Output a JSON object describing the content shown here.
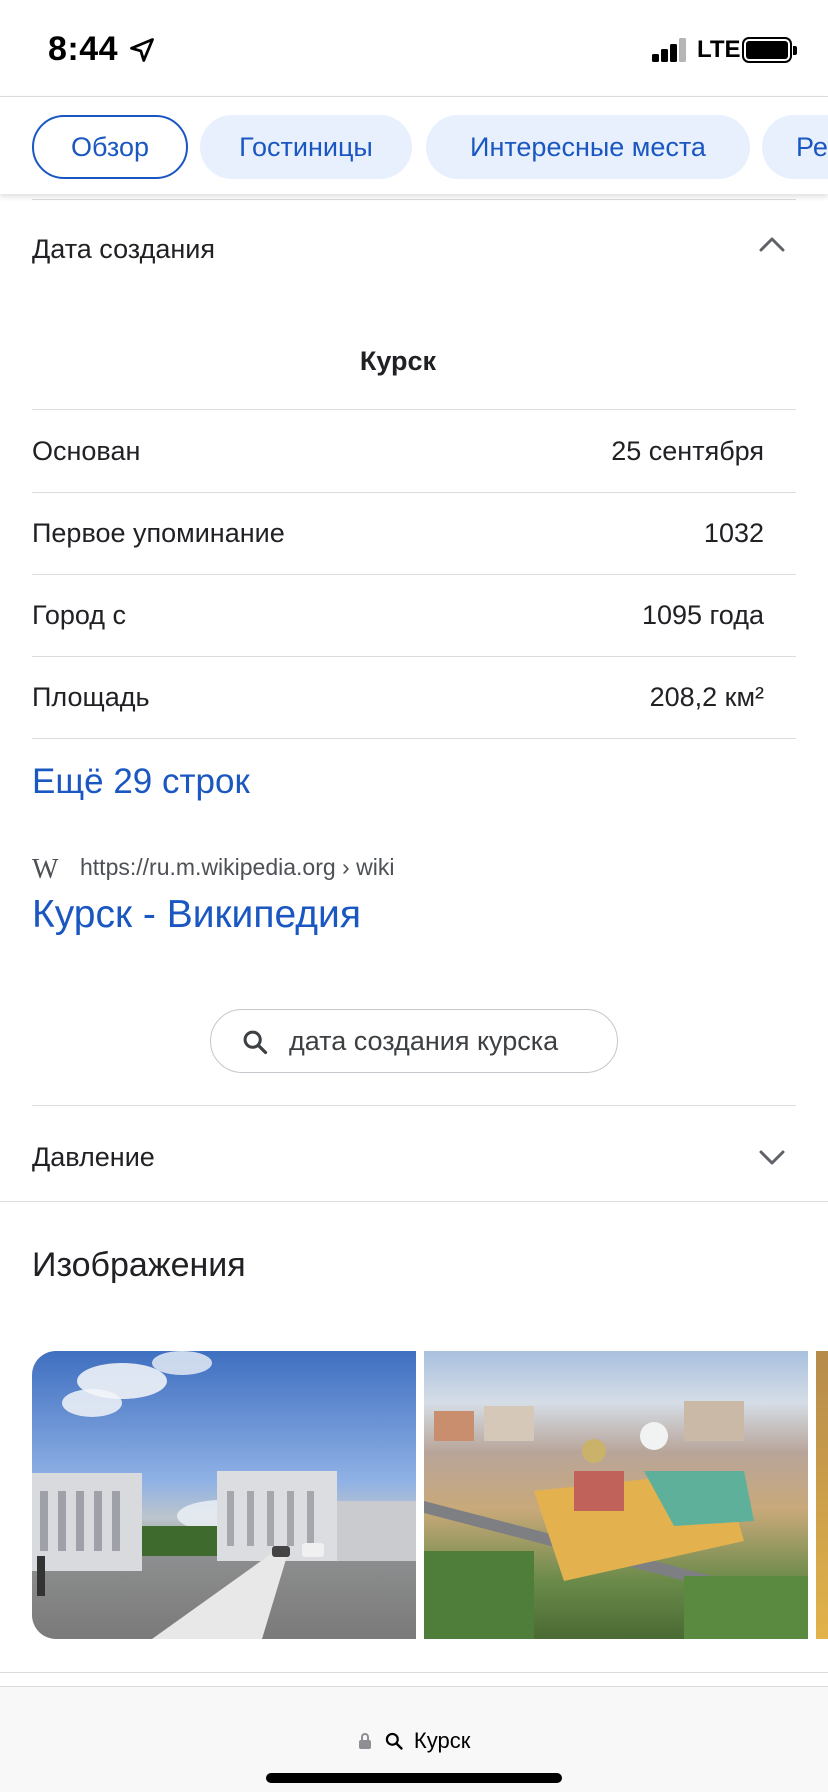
{
  "status_bar": {
    "time": "8:44",
    "network": "LTE"
  },
  "chips": [
    {
      "label": "Обзор",
      "active": true
    },
    {
      "label": "Гостиницы",
      "active": false
    },
    {
      "label": "Интересные места",
      "active": false
    },
    {
      "label": "Ре",
      "active": false
    }
  ],
  "accordion_open": {
    "title": "Дата создания"
  },
  "card": {
    "title": "Курск",
    "rows": [
      {
        "label": "Основан",
        "value": "25 сентября"
      },
      {
        "label": "Первое упоминание",
        "value": "1032"
      },
      {
        "label": "Город с",
        "value": "1095 года"
      },
      {
        "label": "Площадь",
        "value": "208,2 км²"
      }
    ],
    "more_link": "Ещё 29 строк"
  },
  "source": {
    "logo": "W",
    "url": "https://ru.m.wikipedia.org › wiki",
    "title": "Курск - Википедия"
  },
  "related_search": {
    "text": "дата создания курска"
  },
  "accordion_closed": {
    "title": "Давление"
  },
  "images_section": {
    "heading": "Изображения"
  },
  "bottom_bar": {
    "url_text": "Курск"
  },
  "colors": {
    "accent": "#1a57c1",
    "chip_bg": "#e8f0fe",
    "divider": "#dadce0"
  },
  "icons": [
    "location-arrow-icon",
    "signal-icon",
    "battery-icon",
    "chevron-up-icon",
    "chevron-down-icon",
    "search-icon",
    "lock-icon"
  ]
}
